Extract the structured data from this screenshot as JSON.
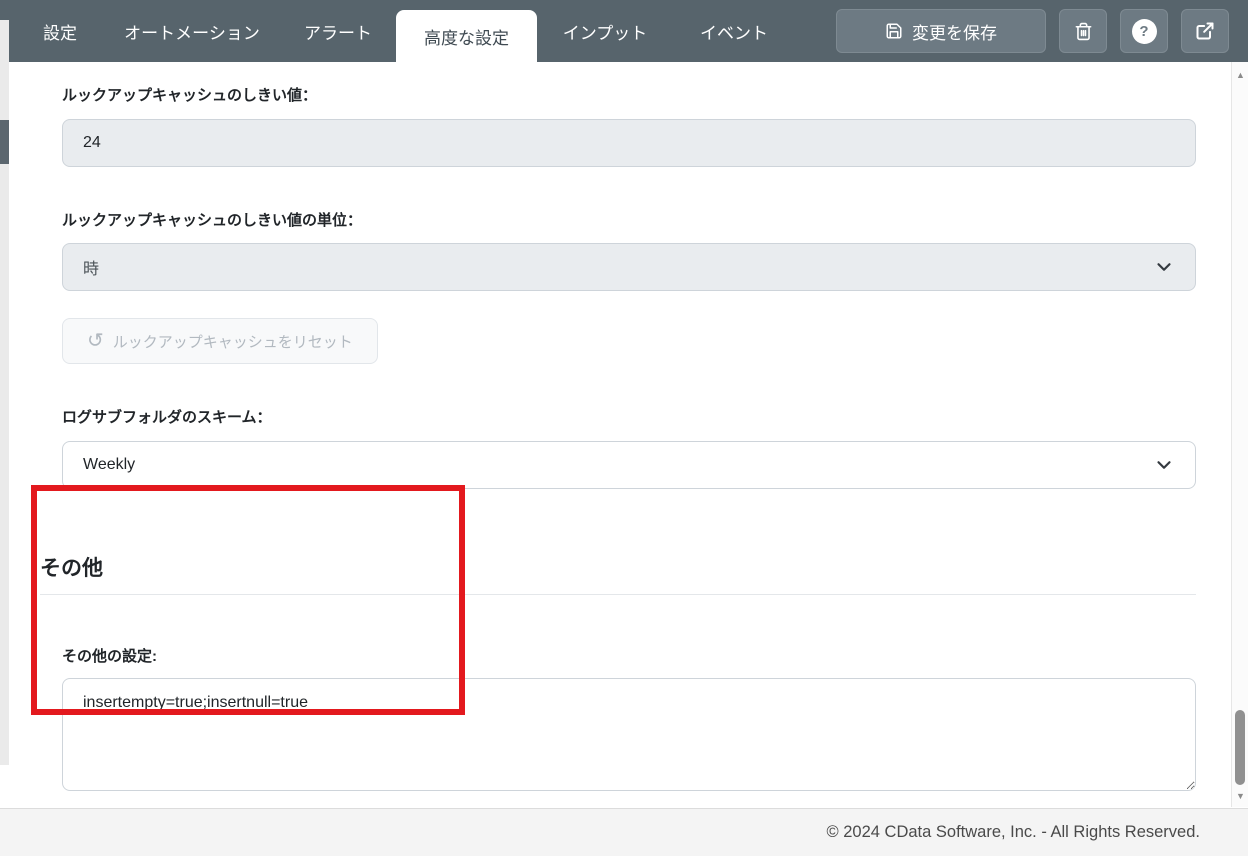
{
  "navbar": {
    "tabs": [
      {
        "label": "設定"
      },
      {
        "label": "オートメーション"
      },
      {
        "label": "アラート"
      },
      {
        "label": "高度な設定"
      },
      {
        "label": "インプット"
      },
      {
        "label": "イベント"
      }
    ],
    "active_tab": "高度な設定",
    "save_button": {
      "label": "変更を保存",
      "icon": "floppy-disk-icon"
    },
    "help_glyph": "?"
  },
  "form": {
    "lookup_threshold": {
      "label": "ルックアップキャッシュのしきい値：",
      "value": "24"
    },
    "lookup_threshold_unit": {
      "label": "ルックアップキャッシュのしきい値の単位：",
      "value": "時"
    },
    "reset_cache_button": {
      "label": "ルックアップキャッシュをリセット",
      "glyph": "↺"
    },
    "log_subfolder_scheme": {
      "label": "ログサブフォルダのスキーム：",
      "value": "Weekly"
    }
  },
  "other_section": {
    "heading": "その他",
    "other_settings": {
      "label": "その他の設定:",
      "value": "insertempty=true;insertnull=true"
    }
  },
  "scrollbar": {
    "up_glyph": "▲",
    "down_glyph": "▼"
  },
  "footer": {
    "copyright": "© 2024 CData Software, Inc. - All Rights Reserved."
  },
  "colors": {
    "navbar_bg": "#57646c",
    "button_bg": "#6d7a83",
    "disabled_field_bg": "#e9ecef",
    "field_border": "#ced4da",
    "annotation_red": "#e3191e"
  }
}
